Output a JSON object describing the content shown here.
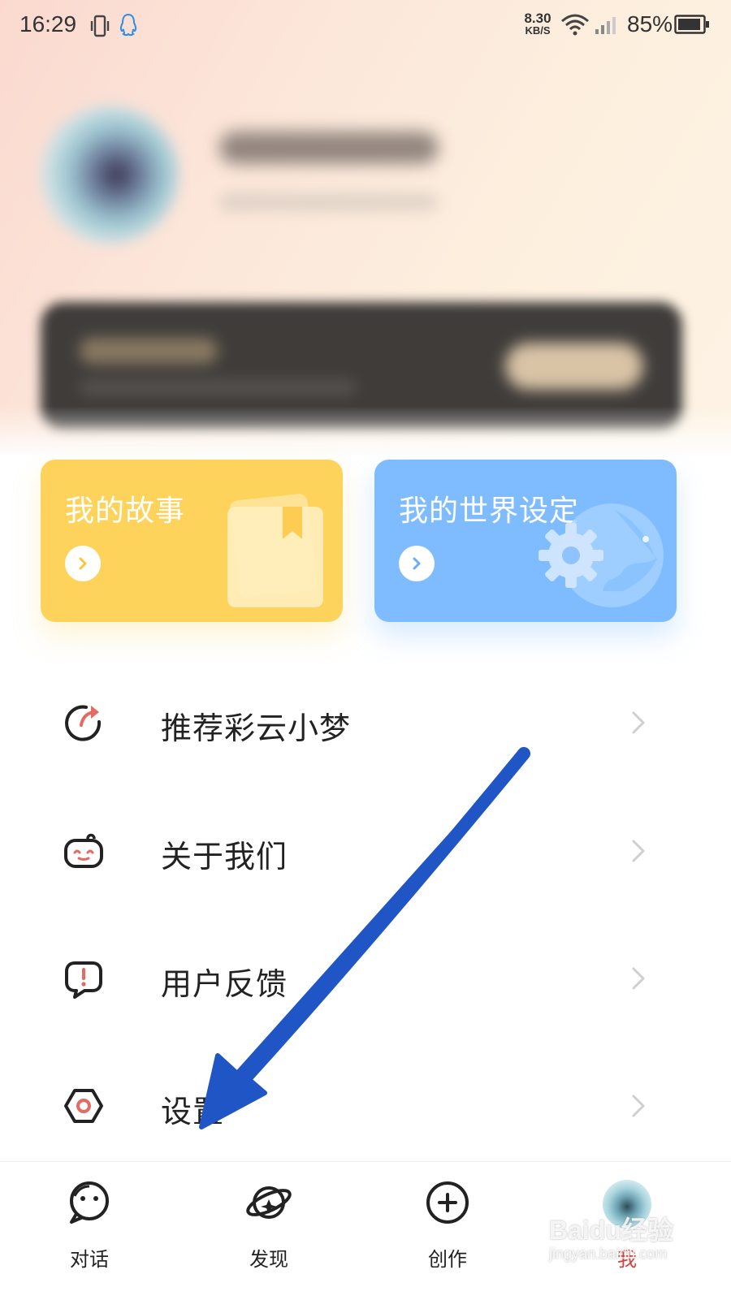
{
  "status_bar": {
    "time": "16:29",
    "net_speed_value": "8.30",
    "net_speed_unit": "KB/S",
    "battery_percent": "85%",
    "icons": [
      "vibrate-icon",
      "qq-icon",
      "wifi-icon",
      "signal-icon",
      "battery-icon"
    ]
  },
  "cards": {
    "story": {
      "title": "我的故事",
      "color": "#fdd35c"
    },
    "world": {
      "title": "我的世界设定",
      "color": "#7fbcff"
    }
  },
  "menu": {
    "items": [
      {
        "label": "推荐彩云小梦",
        "icon": "share-refresh-icon"
      },
      {
        "label": "关于我们",
        "icon": "mascot-face-icon"
      },
      {
        "label": "用户反馈",
        "icon": "feedback-bubble-icon"
      },
      {
        "label": "设置",
        "icon": "settings-hexagon-icon"
      }
    ]
  },
  "tabbar": {
    "tabs": [
      {
        "label": "对话",
        "icon": "chat-face-icon"
      },
      {
        "label": "发现",
        "icon": "discover-planet-icon"
      },
      {
        "label": "创作",
        "icon": "create-plus-icon"
      },
      {
        "label": "我",
        "icon": "avatar"
      }
    ],
    "active_index": 3,
    "active_color": "#d6403e"
  },
  "watermark": {
    "brand": "Baidu经验",
    "url": "jingyan.baidu.com"
  },
  "colors": {
    "accent_red": "#e46a62",
    "annotation_arrow": "#1f55c4"
  }
}
